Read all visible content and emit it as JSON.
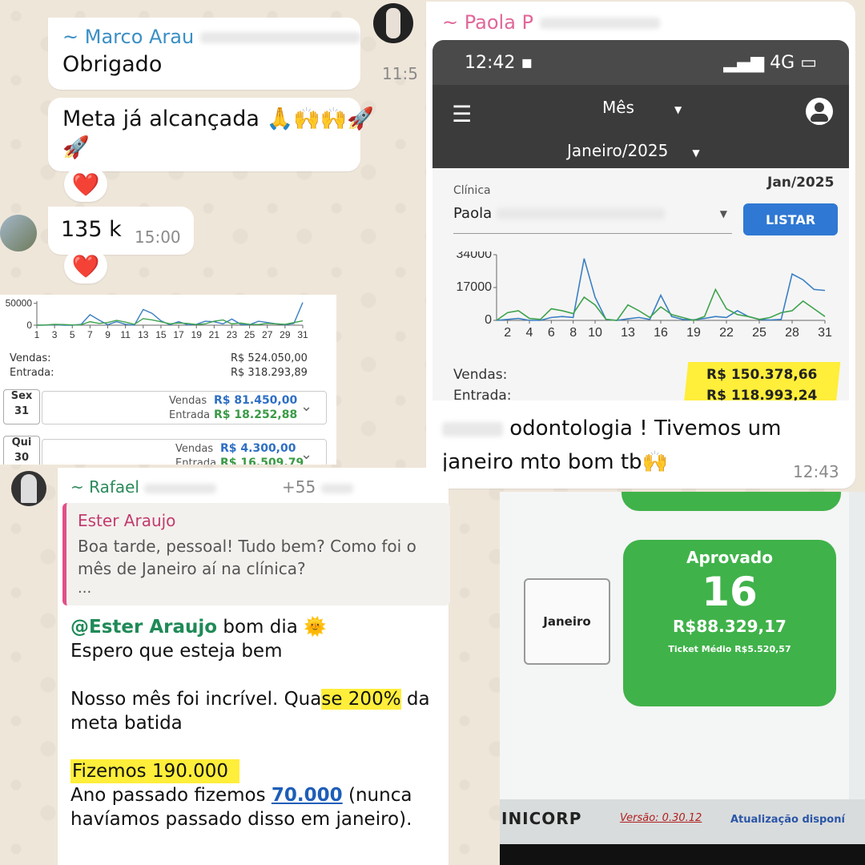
{
  "chat1": {
    "sender": "~ Marco Arau",
    "msg_thanks": "Obrigado",
    "time_thanks": "11:5",
    "msg_goal": "Meta já alcançada 🙏🙌🙌🚀",
    "msg_goal_rocket": "🚀",
    "msg_135k": "135 k",
    "time_135k": "15:00",
    "reaction": "❤️"
  },
  "chart_small": {
    "y_ticks": [
      "50000",
      "0"
    ],
    "x_ticks": [
      "1",
      "3",
      "5",
      "7",
      "9",
      "11",
      "13",
      "15",
      "17",
      "19",
      "21",
      "23",
      "25",
      "27",
      "29",
      "31"
    ],
    "vendas_label": "Vendas:",
    "vendas_value": "R$ 524.050,00",
    "entrada_label": "Entrada:",
    "entrada_value": "R$ 318.293,89",
    "days": [
      {
        "day": "Sex",
        "num": "31",
        "vendas_label": "Vendas",
        "vendas": "R$ 81.450,00",
        "entrada_label": "Entrada",
        "entrada": "R$ 18.252,88"
      },
      {
        "day": "Qui",
        "num": "30",
        "vendas_label": "Vendas",
        "vendas": "R$ 4.300,00",
        "entrada_label": "Entrada",
        "entrada": "R$ 16.509,79"
      }
    ]
  },
  "chat2": {
    "sender": "~ Paola P",
    "status_time": "12:42",
    "network": "4G",
    "period_type": "Mês",
    "period": "Janeiro/2025",
    "period_short": "Jan/2025",
    "clinic_label": "Clínica",
    "clinic_value": "Paola",
    "list_button": "LISTAR",
    "vendas_label": "Vendas:",
    "vendas_value": "R$ 150.378,66",
    "entrada_label": "Entrada:",
    "entrada_value": "R$ 118.993,24",
    "msg": "odontologia ! Tivemos um janeiro mto bom tb🙌",
    "time": "12:43"
  },
  "chart_data": [
    {
      "type": "line",
      "x": [
        1,
        2,
        3,
        4,
        5,
        6,
        7,
        8,
        9,
        10,
        11,
        12,
        13,
        14,
        15,
        16,
        17,
        18,
        19,
        20,
        21,
        22,
        23,
        24,
        25,
        26,
        27,
        28,
        29,
        30,
        31
      ],
      "series": [
        {
          "values": [
            0,
            200,
            1200,
            0,
            0,
            2000,
            24000,
            12000,
            1000,
            8000,
            2000,
            0,
            36000,
            27000,
            10000,
            1000,
            8000,
            1000,
            2000,
            9000,
            8000,
            3000,
            14000,
            2000,
            1000,
            9000,
            6000,
            3000,
            1000,
            4000,
            52000
          ]
        },
        {
          "values": [
            0,
            500,
            2000,
            1500,
            500,
            1000,
            8000,
            4000,
            6000,
            11000,
            7000,
            2000,
            15000,
            12000,
            8000,
            3000,
            5000,
            4000,
            1500,
            3000,
            9000,
            12000,
            3000,
            5000,
            2000,
            1500,
            4000,
            3000,
            2000,
            6000,
            10000
          ]
        }
      ],
      "xlim": [
        1,
        31
      ],
      "ylim": [
        0,
        55000
      ],
      "y_ticks": [
        0,
        50000
      ],
      "colors": {
        "vendas": "#3b7fc4",
        "entrada": "#3fa34d"
      }
    },
    {
      "type": "line",
      "x": [
        1,
        2,
        3,
        4,
        5,
        6,
        7,
        8,
        9,
        10,
        11,
        12,
        13,
        14,
        15,
        16,
        17,
        18,
        19,
        20,
        21,
        22,
        23,
        24,
        25,
        26,
        27,
        28,
        29,
        30,
        31
      ],
      "series": [
        {
          "values": [
            0,
            500,
            1000,
            0,
            0,
            1500,
            2000,
            1500,
            32000,
            12000,
            500,
            0,
            800,
            1500,
            500,
            13000,
            2000,
            500,
            300,
            1000,
            2000,
            1500,
            5000,
            2000,
            500,
            200,
            500,
            24000,
            21000,
            16000,
            15500
          ]
        },
        {
          "values": [
            0,
            4000,
            5000,
            1000,
            500,
            6000,
            5000,
            3500,
            12000,
            8000,
            500,
            0,
            8000,
            5000,
            1500,
            7000,
            3000,
            1500,
            0,
            2000,
            16000,
            6000,
            3000,
            2000,
            500,
            1500,
            4000,
            5000,
            10000,
            6000,
            2000
          ]
        }
      ],
      "xlim": [
        1,
        31
      ],
      "ylim": [
        0,
        34000
      ],
      "y_ticks": [
        0,
        17000,
        34000
      ],
      "x_ticks": [
        2,
        4,
        6,
        8,
        10,
        13,
        16,
        19,
        22,
        25,
        28,
        31
      ],
      "colors": {
        "vendas": "#3b7fc4",
        "entrada": "#3fa34d"
      }
    }
  ],
  "chat3": {
    "sender": "~ Rafael",
    "phone_partial": "+55",
    "quote_author": "Ester Araujo",
    "quote_text": "Boa tarde, pessoal! Tudo bem? Como foi o mês de Janeiro aí na clínica?",
    "quote_more": "...",
    "mention": "@Ester Araujo",
    "line1_rest": " bom dia 🌞",
    "line2": "Espero que esteja bem",
    "line3_a": "Nosso mês foi incrível. Qua",
    "line3_hl": "se 200%",
    "line3_b": " da",
    "line4": "meta batida",
    "line5": "Fizemos 190.000",
    "line6_a": "Ano passado fizemos ",
    "line6_link": "70.000",
    "line6_b": " (nunca",
    "line7": "havíamos passado disso em janeiro)."
  },
  "screen": {
    "month": "Janeiro",
    "status": "Aprovado",
    "count": "16",
    "amount": "R$88.329,17",
    "ticket": "Ticket Médio R$5.520,57",
    "brand": "INICORP",
    "version": "Versão: 0.30.12",
    "update": "Atualização disponí"
  }
}
